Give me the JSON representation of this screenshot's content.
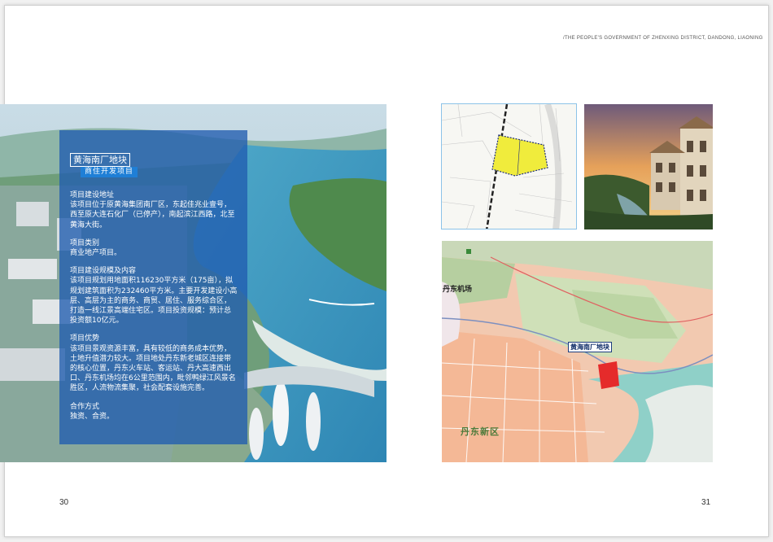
{
  "header": {
    "text": "/THE PEOPLE'S GOVERNMENT OF ZHENXING DISTRICT, DANDONG, LIAONING"
  },
  "panel": {
    "title": "黄海南厂地块",
    "subtitle": "商住开发项目",
    "sections": [
      {
        "heading": "项目建设地址",
        "body": "该项目位于原黄海集团南厂区，东起佳兆业壹号，西至原大连石化厂（已停产），南起滨江西路，北至黄海大街。"
      },
      {
        "heading": "项目类别",
        "body": "商业地产项目。"
      },
      {
        "heading": "项目建设规模及内容",
        "body": "该项目规划用地面积116230平方米（175亩），拟规划建筑面积为232460平方米。主要开发建设小高层、高层为主的商务、商贸、居住、服务综合区，打造一线江景高端住宅区。项目投资规模：预计总投资额10亿元。"
      },
      {
        "heading": "项目优势",
        "body": "该项目景观资源丰富，具有较低的商务成本优势，土地升值潜力较大。项目地处丹东新老城区连接带的核心位置，丹东火车站、客运站、丹大高速西出口、丹东机场均在6公里范围内，毗邻鸭绿江风景名胜区，人流物流集聚，社会配套设施完善。"
      },
      {
        "heading": "合作方式",
        "body": "独资、合资。"
      }
    ]
  },
  "map_labels": {
    "airport": "丹东机场",
    "plot": "黄海南厂地块",
    "district": "丹东新区"
  },
  "page_numbers": {
    "left": "30",
    "right": "31"
  }
}
